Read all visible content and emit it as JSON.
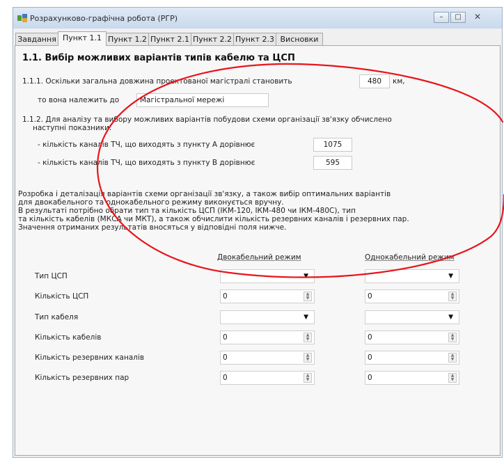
{
  "window": {
    "title": "Розрахунково-графічна робота (РГР)",
    "min": "–",
    "max": "□",
    "close": "✕"
  },
  "tabs": [
    "Завдання",
    "Пункт 1.1",
    "Пункт 1.2",
    "Пункт 2.1",
    "Пункт 2.2",
    "Пункт 2.3",
    "Висновки"
  ],
  "active_tab": "Пункт 1.1",
  "section": {
    "heading": "1.1. Вибір можливих варіантів типів кабелю та ЦСП",
    "p111_text": "1.1.1. Оскільки загальна довжина проектованої магістралі становить",
    "length_value": "480",
    "length_unit": "км,",
    "belongs_text": "то вона належить до",
    "network_value": "Магістральної мережі",
    "p112_line1": "1.1.2. Для аналізу та вибору можливих варіантів побудови схеми організації зв'язку обчислено",
    "p112_line2": "наступні показники:",
    "channels_a_label": "- кількість каналів ТЧ, що виходять з пункту А дорівнює",
    "channels_a_value": "1075",
    "channels_b_label": "- кількість каналів ТЧ, що виходять з пункту В дорівнює",
    "channels_b_value": "595",
    "info_lines": [
      "Розробка і деталізація варіантів схеми організації зв'язку, а також вибір оптимальних варіантів",
      "для двокабельного та однокабельного режиму виконується вручну.",
      "В результаті потрібно обрати тип та кількість ЦСП (ІКМ-120, ІКМ-480 чи ІКМ-480С), тип",
      "та кількість кабелів (МКСА чи МКТ), а також обчислити кількість резервних каналів і резервних пар.",
      "Значення отриманих результатів вносяться у відповідні поля нижче."
    ]
  },
  "form": {
    "col_two_cable": "Двокабельний режим",
    "col_one_cable": "Однокабельний режим",
    "rows": [
      {
        "label": "Тип ЦСП",
        "kind": "combo",
        "two": "",
        "one": ""
      },
      {
        "label": "Кількість ЦСП",
        "kind": "spin",
        "two": "0",
        "one": "0"
      },
      {
        "label": "Тип кабеля",
        "kind": "combo",
        "two": "",
        "one": ""
      },
      {
        "label": "Кількість кабелів",
        "kind": "spin",
        "two": "0",
        "one": "0"
      },
      {
        "label": "Кількість резервних каналів",
        "kind": "spin",
        "two": "0",
        "one": "0"
      },
      {
        "label": "Кількість резервних пар",
        "kind": "spin",
        "two": "0",
        "one": "0"
      }
    ]
  },
  "icons": {
    "dropdown": "▼",
    "spin_up": "▲",
    "spin_down": "▼"
  },
  "colors": {
    "annotation": "#e8141b",
    "titlebar": "#c9d9ec",
    "panel": "#f7f7f7"
  }
}
